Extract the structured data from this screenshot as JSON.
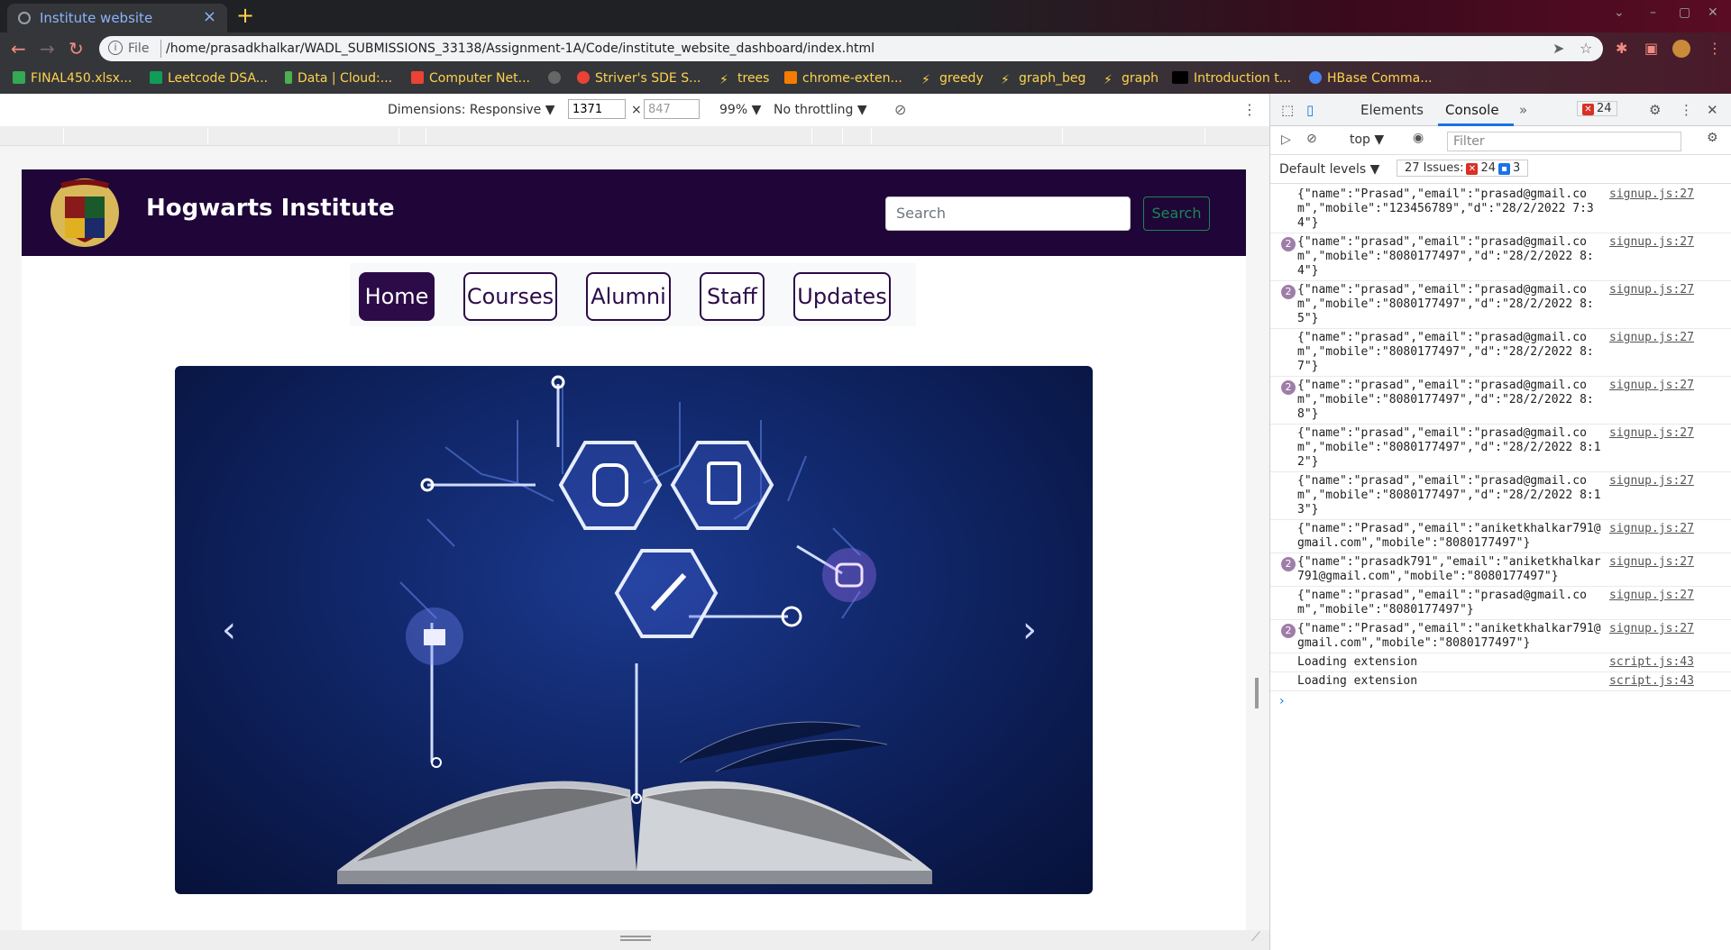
{
  "browser": {
    "tab_title": "Institute website",
    "new_tab": "+",
    "tab_close": "×",
    "url_scheme": "File",
    "url": "/home/prasadkhalkar/WADL_SUBMISSIONS_33138/Assignment-1A/Code/institute_website_dashboard/index.html",
    "bookmarks": [
      {
        "label": "FINAL450.xlsx...",
        "color": "#34a853"
      },
      {
        "label": "Leetcode DSA...",
        "color": "#0f9d58"
      },
      {
        "label": "Data | Cloud:...",
        "color": "#4caf50"
      },
      {
        "label": "Computer Net...",
        "color": "#ea4335"
      },
      {
        "label": "Striver's SDE S...",
        "color": "#ea4335"
      },
      {
        "label": "trees",
        "color": "#fcd34d"
      },
      {
        "label": "chrome-exten...",
        "color": "#f57c00"
      },
      {
        "label": "greedy",
        "color": "#fcd34d"
      },
      {
        "label": "graph_beg",
        "color": "#fcd34d"
      },
      {
        "label": "graph",
        "color": "#fcd34d"
      },
      {
        "label": "Introduction t...",
        "color": "#ffffff"
      },
      {
        "label": "HBase Comma...",
        "color": "#4285f4"
      }
    ]
  },
  "device_toolbar": {
    "dimensions_label": "Dimensions: Responsive ▼",
    "width": "1371",
    "times": "×",
    "height": "847",
    "zoom": "99% ▼",
    "throttling": "No throttling ▼"
  },
  "site": {
    "title": "Hogwarts Institute",
    "search_placeholder": "Search",
    "search_button": "Search",
    "nav": [
      "Home",
      "Courses",
      "Alumni",
      "Staff",
      "Updates"
    ],
    "prev_arrow": "‹",
    "next_arrow": "›"
  },
  "devtools": {
    "tabs": [
      "Elements",
      "Console",
      "»"
    ],
    "error_count": "24",
    "context": "top ▼",
    "filter_placeholder": "Filter",
    "default_levels": "Default levels ▼",
    "issues_label": "27 Issues:",
    "issues_errors": "24",
    "issues_info": "3",
    "logs": [
      {
        "count": "",
        "msg": "{\"name\":\"Prasad\",\"email\":\"prasad@gmail.com\",\"mobile\":\"123456789\",\"d\":\"28/2/2022 7:34\"}",
        "src": "signup.js:27"
      },
      {
        "count": "2",
        "msg": "{\"name\":\"prasad\",\"email\":\"prasad@gmail.com\",\"mobile\":\"8080177497\",\"d\":\"28/2/2022 8:4\"}",
        "src": "signup.js:27"
      },
      {
        "count": "2",
        "msg": "{\"name\":\"prasad\",\"email\":\"prasad@gmail.com\",\"mobile\":\"8080177497\",\"d\":\"28/2/2022 8:5\"}",
        "src": "signup.js:27"
      },
      {
        "count": "",
        "msg": "{\"name\":\"prasad\",\"email\":\"prasad@gmail.com\",\"mobile\":\"8080177497\",\"d\":\"28/2/2022 8:7\"}",
        "src": "signup.js:27"
      },
      {
        "count": "2",
        "msg": "{\"name\":\"prasad\",\"email\":\"prasad@gmail.com\",\"mobile\":\"8080177497\",\"d\":\"28/2/2022 8:8\"}",
        "src": "signup.js:27"
      },
      {
        "count": "",
        "msg": "{\"name\":\"prasad\",\"email\":\"prasad@gmail.com\",\"mobile\":\"8080177497\",\"d\":\"28/2/2022 8:12\"}",
        "src": "signup.js:27"
      },
      {
        "count": "",
        "msg": "{\"name\":\"prasad\",\"email\":\"prasad@gmail.com\",\"mobile\":\"8080177497\",\"d\":\"28/2/2022 8:13\"}",
        "src": "signup.js:27"
      },
      {
        "count": "",
        "msg": "{\"name\":\"Prasad\",\"email\":\"aniketkhalkar791@gmail.com\",\"mobile\":\"8080177497\"}",
        "src": "signup.js:27"
      },
      {
        "count": "2",
        "msg": "{\"name\":\"prasadk791\",\"email\":\"aniketkhalkar791@gmail.com\",\"mobile\":\"8080177497\"}",
        "src": "signup.js:27"
      },
      {
        "count": "",
        "msg": "{\"name\":\"prasad\",\"email\":\"prasad@gmail.com\",\"mobile\":\"8080177497\"}",
        "src": "signup.js:27"
      },
      {
        "count": "2",
        "msg": "{\"name\":\"Prasad\",\"email\":\"aniketkhalkar791@gmail.com\",\"mobile\":\"8080177497\"}",
        "src": "signup.js:27"
      },
      {
        "count": "",
        "msg": "Loading extension",
        "src": "script.js:43"
      },
      {
        "count": "",
        "msg": "Loading extension",
        "src": "script.js:43"
      }
    ],
    "prompt": "›"
  },
  "colors": {
    "header_bg": "#1f0538",
    "nav_accent": "#2c0b48",
    "search_green": "#198754",
    "carousel_bg": "#0b1a4d"
  }
}
